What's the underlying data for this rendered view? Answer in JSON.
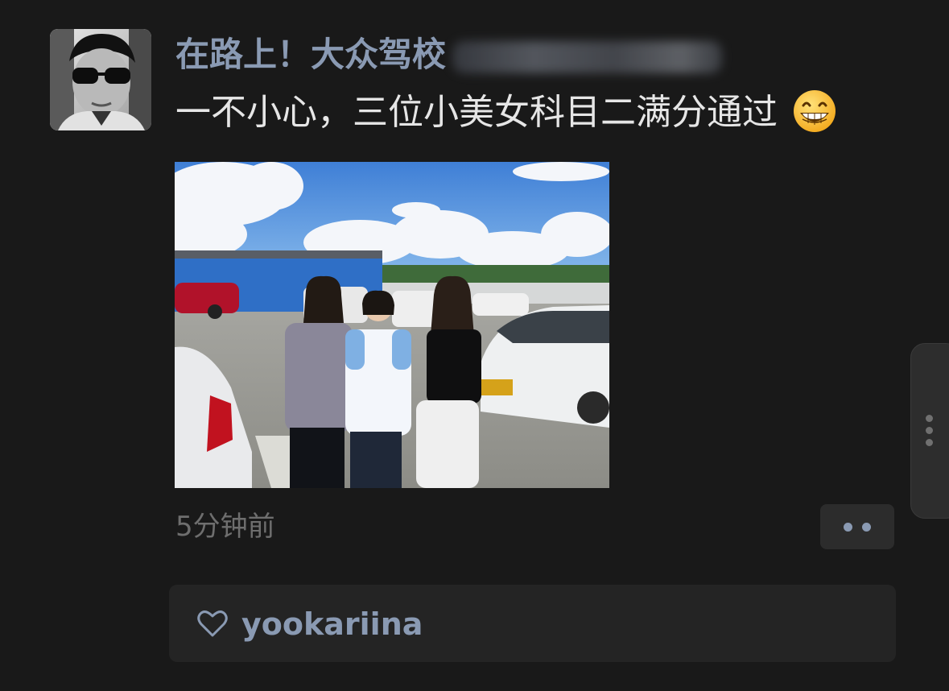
{
  "post": {
    "author_name": "在路上！大众驾校",
    "author_blurred": true,
    "text": "一不小心，三位小美女科目二满分通过",
    "text_emoji": "grinning-face-emoji",
    "photo_icon": "photo-three-girls-driving-school",
    "timestamp": "5分钟前",
    "more_icon": "more-dots-icon"
  },
  "likes": {
    "icon": "heart-icon",
    "users": [
      "yookariina"
    ]
  },
  "side_handle": {
    "icon": "vertical-dots-icon"
  },
  "colors": {
    "background": "#191919",
    "link_blue": "#8a9ab3",
    "text": "#e6e6e6",
    "muted": "#6e6e6e",
    "panel": "#242424"
  }
}
